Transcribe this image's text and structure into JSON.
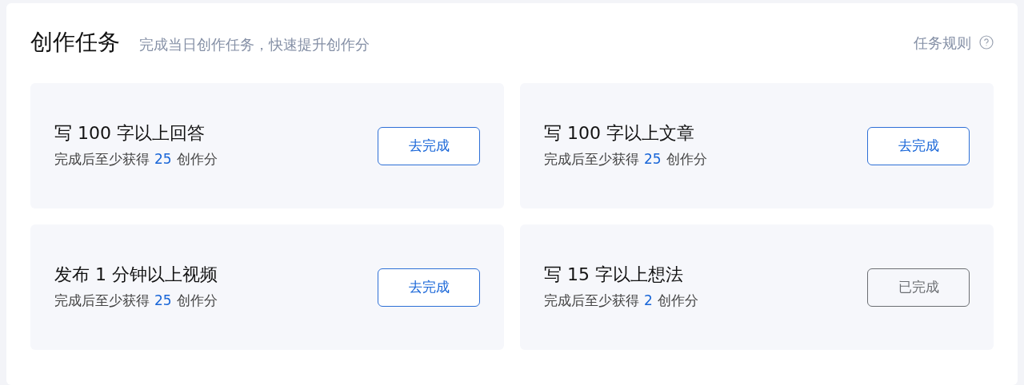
{
  "header": {
    "title": "创作任务",
    "subtitle": "完成当日创作任务，快速提升创作分",
    "rules_link": "任务规则"
  },
  "tasks": [
    {
      "title": "写 100 字以上回答",
      "reward_prefix": "完成后至少获得",
      "points": "25",
      "reward_suffix": "创作分",
      "button": "去完成",
      "completed": false
    },
    {
      "title": "写 100 字以上文章",
      "reward_prefix": "完成后至少获得",
      "points": "25",
      "reward_suffix": "创作分",
      "button": "去完成",
      "completed": false
    },
    {
      "title": "发布 1 分钟以上视频",
      "reward_prefix": "完成后至少获得",
      "points": "25",
      "reward_suffix": "创作分",
      "button": "去完成",
      "completed": false
    },
    {
      "title": "写 15 字以上想法",
      "reward_prefix": "完成后至少获得",
      "points": "2",
      "reward_suffix": "创作分",
      "button": "已完成",
      "completed": true
    }
  ]
}
